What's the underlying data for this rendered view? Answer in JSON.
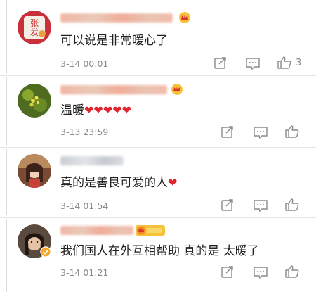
{
  "colors": {
    "text": "#222222",
    "meta": "#8a8a8a",
    "heart": "#e0242e",
    "separator": "#e6e6e6"
  },
  "icons": {
    "share": "share-icon",
    "comment": "comment-icon",
    "like": "thumbs-up-icon",
    "crown": "crown-badge-icon",
    "verified": "verified-badge-icon"
  },
  "comments": [
    {
      "text": "可以说是非常暖心了",
      "time": "3-14 00:01",
      "likes": "3"
    },
    {
      "text": "温暖",
      "hearts": "❤❤❤❤❤",
      "time": "3-13 23:59",
      "likes": ""
    },
    {
      "text": "真的是善良可爱的人",
      "hearts": "❤",
      "time": "3-14 01:54",
      "likes": ""
    },
    {
      "text": "我们国人在外互相帮助 真的是 太暖了",
      "time": "3-14 01:21",
      "likes": ""
    }
  ]
}
